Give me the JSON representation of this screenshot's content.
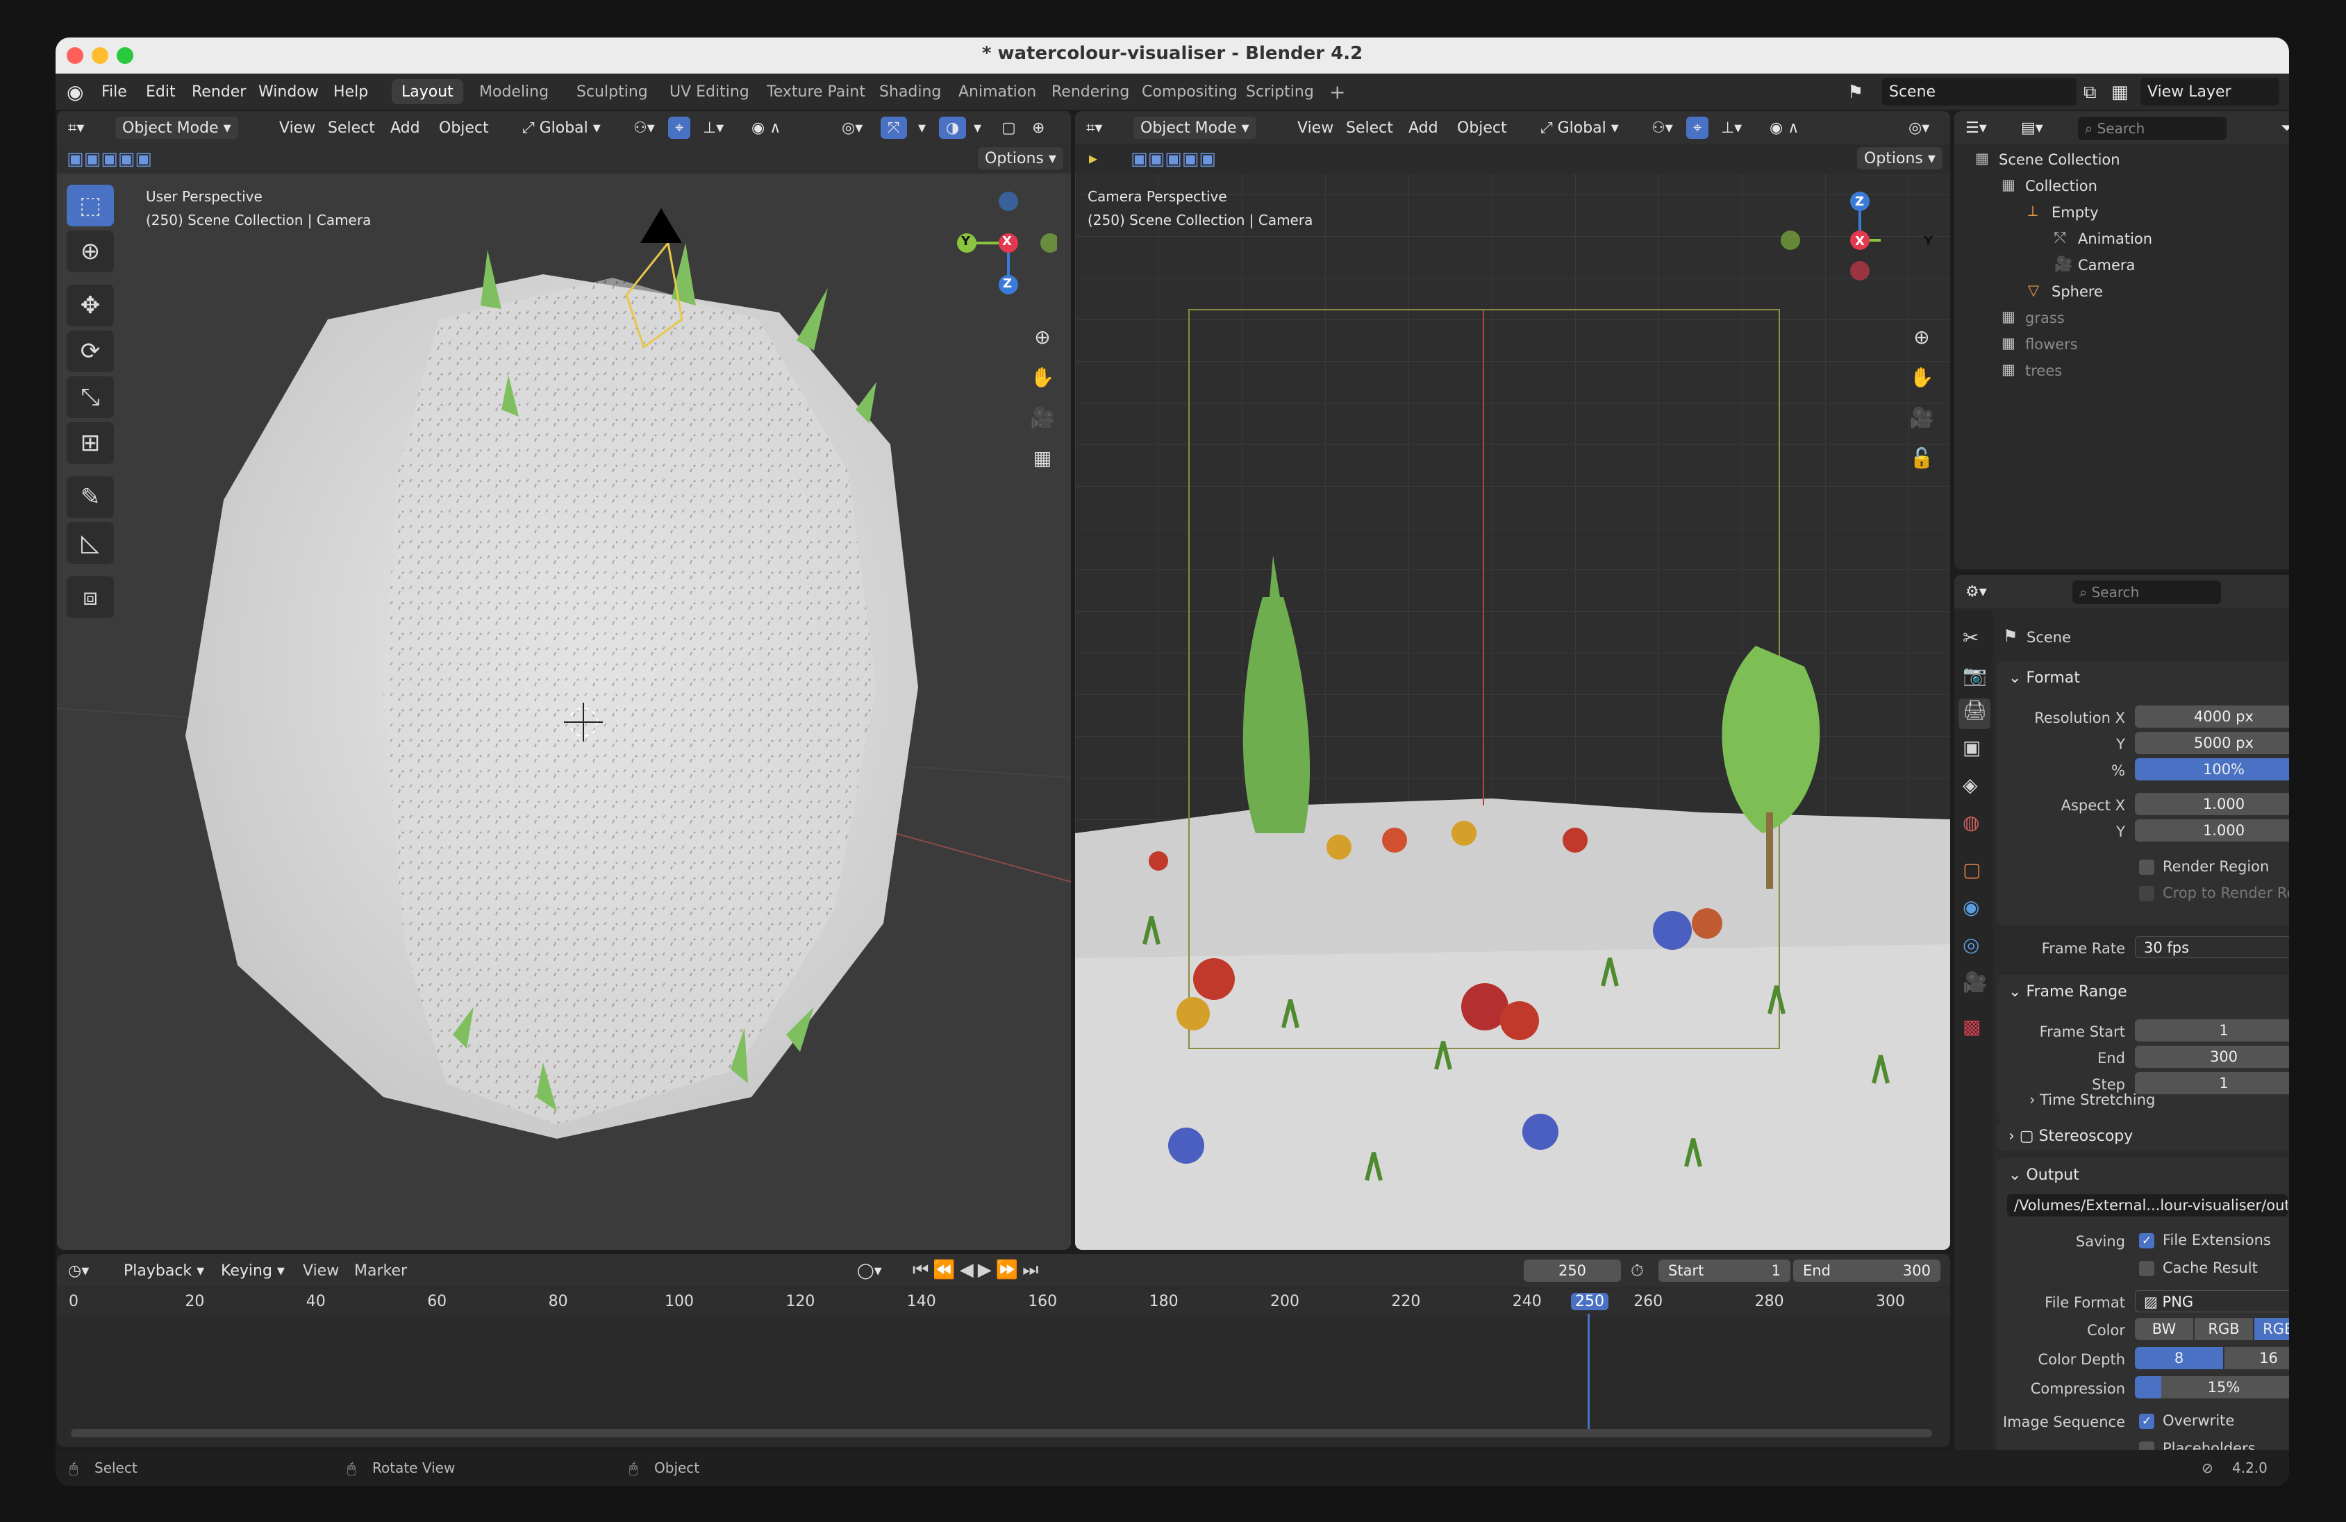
{
  "window": {
    "title": "* watercolour-visualiser - Blender 4.2"
  },
  "menu": [
    "File",
    "Edit",
    "Render",
    "Window",
    "Help"
  ],
  "workspaces": [
    "Layout",
    "Modeling",
    "Sculpting",
    "UV Editing",
    "Texture Paint",
    "Shading",
    "Animation",
    "Rendering",
    "Compositing",
    "Scripting"
  ],
  "topbar": {
    "add_workspace": "+",
    "scene": "Scene",
    "view_layer": "View Layer"
  },
  "left_view": {
    "mode": "Object Mode",
    "menus": [
      "View",
      "Select",
      "Add",
      "Object"
    ],
    "transform": "Global",
    "options": "Options",
    "overlay_line1": "User Perspective",
    "overlay_line2": "(250) Scene Collection | Camera",
    "gizmo": {
      "y": "Y",
      "x": "X",
      "z": "Z"
    }
  },
  "right_view": {
    "mode": "Object Mode",
    "menus": [
      "View",
      "Select",
      "Add",
      "Object"
    ],
    "transform": "Global",
    "options": "Options",
    "overlay_line1": "Camera Perspective",
    "overlay_line2": "(250) Scene Collection | Camera",
    "gizmo": {
      "y": "Y",
      "x": "X",
      "z": "Z"
    }
  },
  "outliner": {
    "search_placeholder": "Search",
    "items": [
      {
        "name": "Scene Collection",
        "indent": 0
      },
      {
        "name": "Collection",
        "indent": 1
      },
      {
        "name": "Empty",
        "indent": 2
      },
      {
        "name": "Animation",
        "indent": 3
      },
      {
        "name": "Camera",
        "indent": 3
      },
      {
        "name": "Sphere",
        "indent": 2
      },
      {
        "name": "grass",
        "indent": 1
      },
      {
        "name": "flowers",
        "indent": 1
      },
      {
        "name": "trees",
        "indent": 1
      }
    ]
  },
  "properties": {
    "search_placeholder": "Search",
    "context": "Scene",
    "format": {
      "title": "Format",
      "res_x_label": "Resolution X",
      "res_x": "4000 px",
      "res_y_label": "Y",
      "res_y": "5000 px",
      "pct_label": "%",
      "pct": "100%",
      "pct_value": 1.0,
      "aspect_x_label": "Aspect X",
      "aspect_x": "1.000",
      "aspect_y_label": "Y",
      "aspect_y": "1.000",
      "render_region": "Render Region",
      "crop": "Crop to Render Regi...",
      "frame_rate_label": "Frame Rate",
      "frame_rate": "30 fps"
    },
    "frame_range": {
      "title": "Frame Range",
      "start_label": "Frame Start",
      "start": "1",
      "end_label": "End",
      "end": "300",
      "step_label": "Step",
      "step": "1"
    },
    "time_stretching": "Time Stretching",
    "stereoscopy": "Stereoscopy",
    "output": {
      "title": "Output",
      "path": "/Volumes/External...lour-visualiser/out/",
      "saving_label": "Saving",
      "file_ext": "File Extensions",
      "cache": "Cache Result",
      "file_format_label": "File Format",
      "file_format": "PNG",
      "color_label": "Color",
      "color_opts": [
        "BW",
        "RGB",
        "RGBA"
      ],
      "depth_label": "Color Depth",
      "depth_opts": [
        "8",
        "16"
      ],
      "compression_label": "Compression",
      "compression": "15%",
      "compression_value": 0.15,
      "image_seq_label": "Image Sequence",
      "overwrite": "Overwrite",
      "placeholders": "Placeholders"
    }
  },
  "timeline": {
    "menus": [
      "Playback",
      "Keying",
      "View",
      "Marker"
    ],
    "current_frame": "250",
    "start_label": "Start",
    "start": "1",
    "end_label": "End",
    "end": "300",
    "ticks": [
      "0",
      "20",
      "40",
      "60",
      "80",
      "100",
      "120",
      "140",
      "160",
      "180",
      "200",
      "220",
      "240",
      "250",
      "260",
      "280",
      "300"
    ],
    "playhead": 250
  },
  "status": {
    "select": "Select",
    "rotate": "Rotate View",
    "object": "Object",
    "version": "4.2.0"
  },
  "colors": {
    "accent": "#4a72c4",
    "axis_x": "#e2394f",
    "axis_y": "#8bc53f",
    "axis_z": "#3b7bd8"
  }
}
